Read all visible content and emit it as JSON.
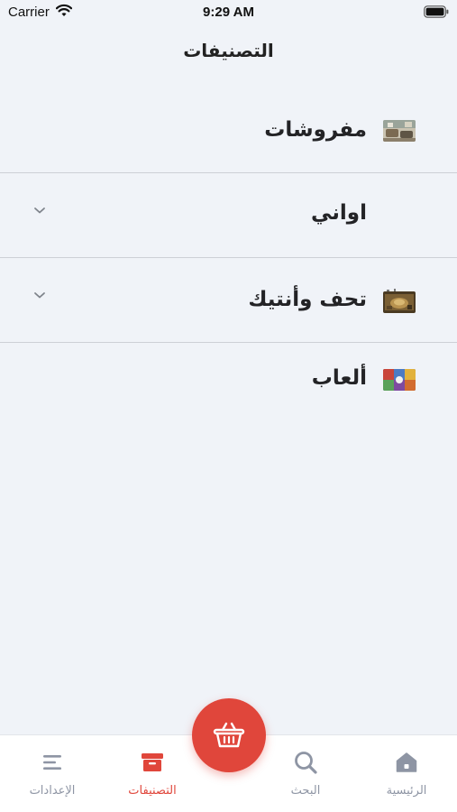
{
  "status_bar": {
    "carrier": "Carrier",
    "time": "9:29 AM"
  },
  "header": {
    "title": "التصنيفات"
  },
  "categories": [
    {
      "label": "مفروشات",
      "thumb_icon": "furniture-thumbnail",
      "expandable": false
    },
    {
      "label": "اواني",
      "thumb_icon": "cookware-thumbnail",
      "expandable": true
    },
    {
      "label": "تحف وأنتيك",
      "thumb_icon": "antiques-thumbnail",
      "expandable": true
    },
    {
      "label": "ألعاب",
      "thumb_icon": "toys-thumbnail",
      "expandable": false
    }
  ],
  "tab_bar": {
    "tabs": [
      {
        "label": "الإعدادات",
        "icon": "menu-lines-icon",
        "active": false
      },
      {
        "label": "التصنيفات",
        "icon": "box-icon",
        "active": true
      },
      {
        "label": "البحث",
        "icon": "search-icon",
        "active": false
      },
      {
        "label": "الرئيسية",
        "icon": "home-icon",
        "active": false
      }
    ],
    "fab_icon": "basket-icon"
  },
  "colors": {
    "accent": "#e0463b",
    "background": "#f0f3f8",
    "inactive_tab": "#8e95a4"
  }
}
